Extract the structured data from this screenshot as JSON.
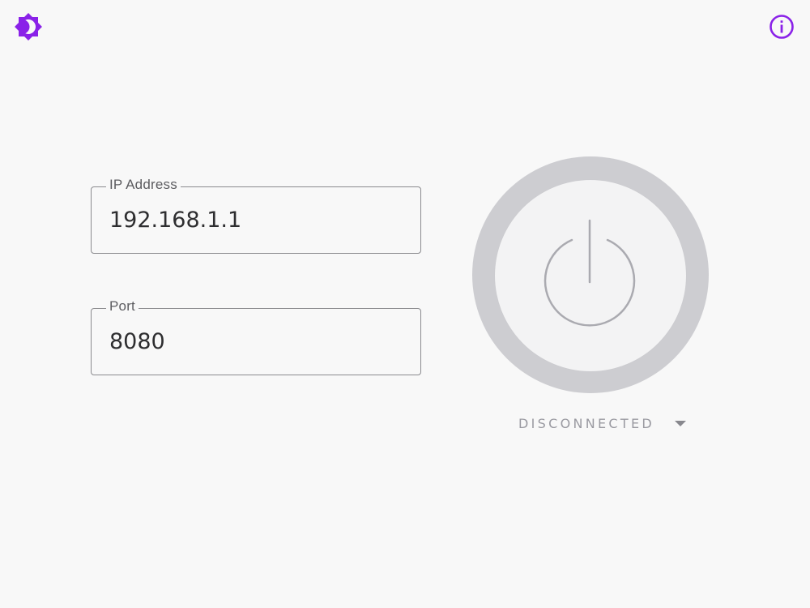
{
  "header": {
    "theme_icon": "brightness-icon",
    "info_icon": "info-icon",
    "accent_color": "#8a22e8"
  },
  "form": {
    "ip": {
      "label": "IP Address",
      "value": "192.168.1.1"
    },
    "port": {
      "label": "Port",
      "value": "8080"
    }
  },
  "connection": {
    "power_icon": "power-icon",
    "status": "DISCONNECTED",
    "status_icon": "caret-down-icon"
  }
}
